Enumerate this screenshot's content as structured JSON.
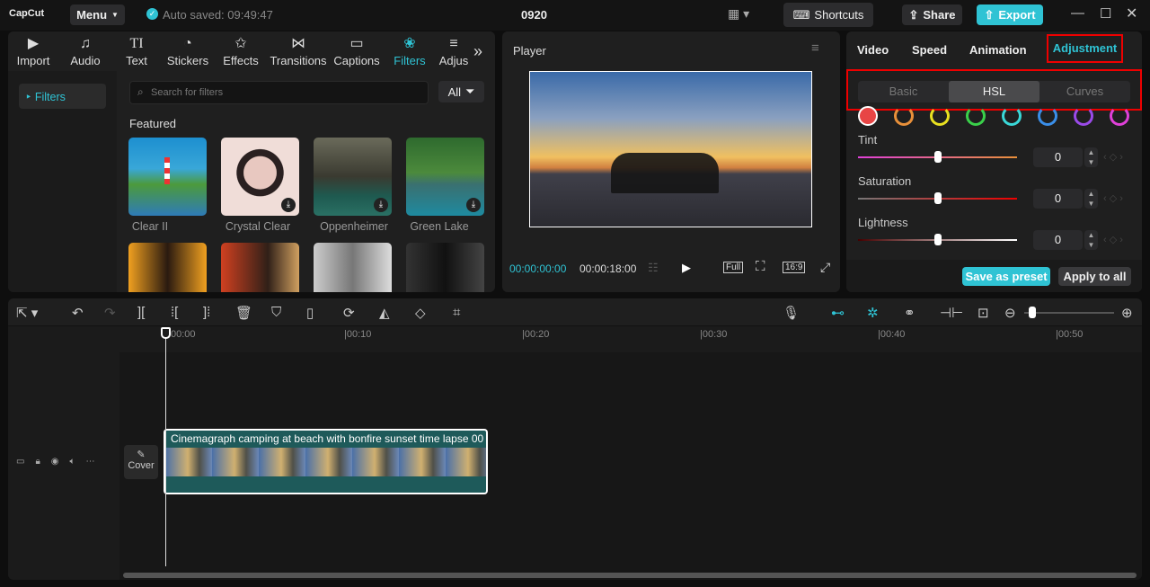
{
  "titlebar": {
    "logo": "CapCut",
    "menu": "Menu",
    "autosave": "Auto saved: 09:49:47",
    "project": "0920",
    "shortcuts": "Shortcuts",
    "share": "Share",
    "export": "Export"
  },
  "media_tabs": [
    {
      "label": "Import",
      "icon": "▶"
    },
    {
      "label": "Audio",
      "icon": "♫"
    },
    {
      "label": "Text",
      "icon": "TI"
    },
    {
      "label": "Stickers",
      "icon": "◔"
    },
    {
      "label": "Effects",
      "icon": "✩"
    },
    {
      "label": "Transitions",
      "icon": "⋈"
    },
    {
      "label": "Captions",
      "icon": "▭"
    },
    {
      "label": "Filters",
      "icon": "❀"
    },
    {
      "label": "Adjus",
      "icon": "≡"
    }
  ],
  "filters": {
    "sidebar_item": "Filters",
    "search_placeholder": "Search for filters",
    "all_label": "All",
    "section": "Featured",
    "items": [
      {
        "name": "Clear II"
      },
      {
        "name": "Crystal Clear"
      },
      {
        "name": "Oppenheimer"
      },
      {
        "name": "Green Lake"
      }
    ]
  },
  "player": {
    "title": "Player",
    "current_time": "00:00:00:00",
    "total_time": "00:00:18:00",
    "full": "Full",
    "ratio": "16:9"
  },
  "right_panel": {
    "tabs": [
      "Video",
      "Speed",
      "Animation",
      "Adjustment"
    ],
    "active_tab": "Adjustment",
    "subtabs": [
      "Basic",
      "HSL",
      "Curves"
    ],
    "active_subtab": "HSL",
    "colors": [
      "#e84545",
      "#e8903a",
      "#e8e020",
      "#3ad04a",
      "#3ad8d8",
      "#3a8ee8",
      "#9a4ae8",
      "#e040d8"
    ],
    "sliders": [
      {
        "label": "Tint",
        "value": "0",
        "fraction": 0.5
      },
      {
        "label": "Saturation",
        "value": "0",
        "fraction": 0.5
      },
      {
        "label": "Lightness",
        "value": "0",
        "fraction": 0.5
      }
    ],
    "save_preset": "Save as preset",
    "apply_all": "Apply to all"
  },
  "timeline": {
    "ticks": [
      "00:00",
      "|00:10",
      "|00:20",
      "|00:30",
      "|00:40",
      "|00:50"
    ],
    "cover": "Cover",
    "clip_title": "Cinemagraph camping at beach with bonfire sunset time lapse",
    "clip_suffix": "00"
  },
  "accent": "#2fc3d4"
}
